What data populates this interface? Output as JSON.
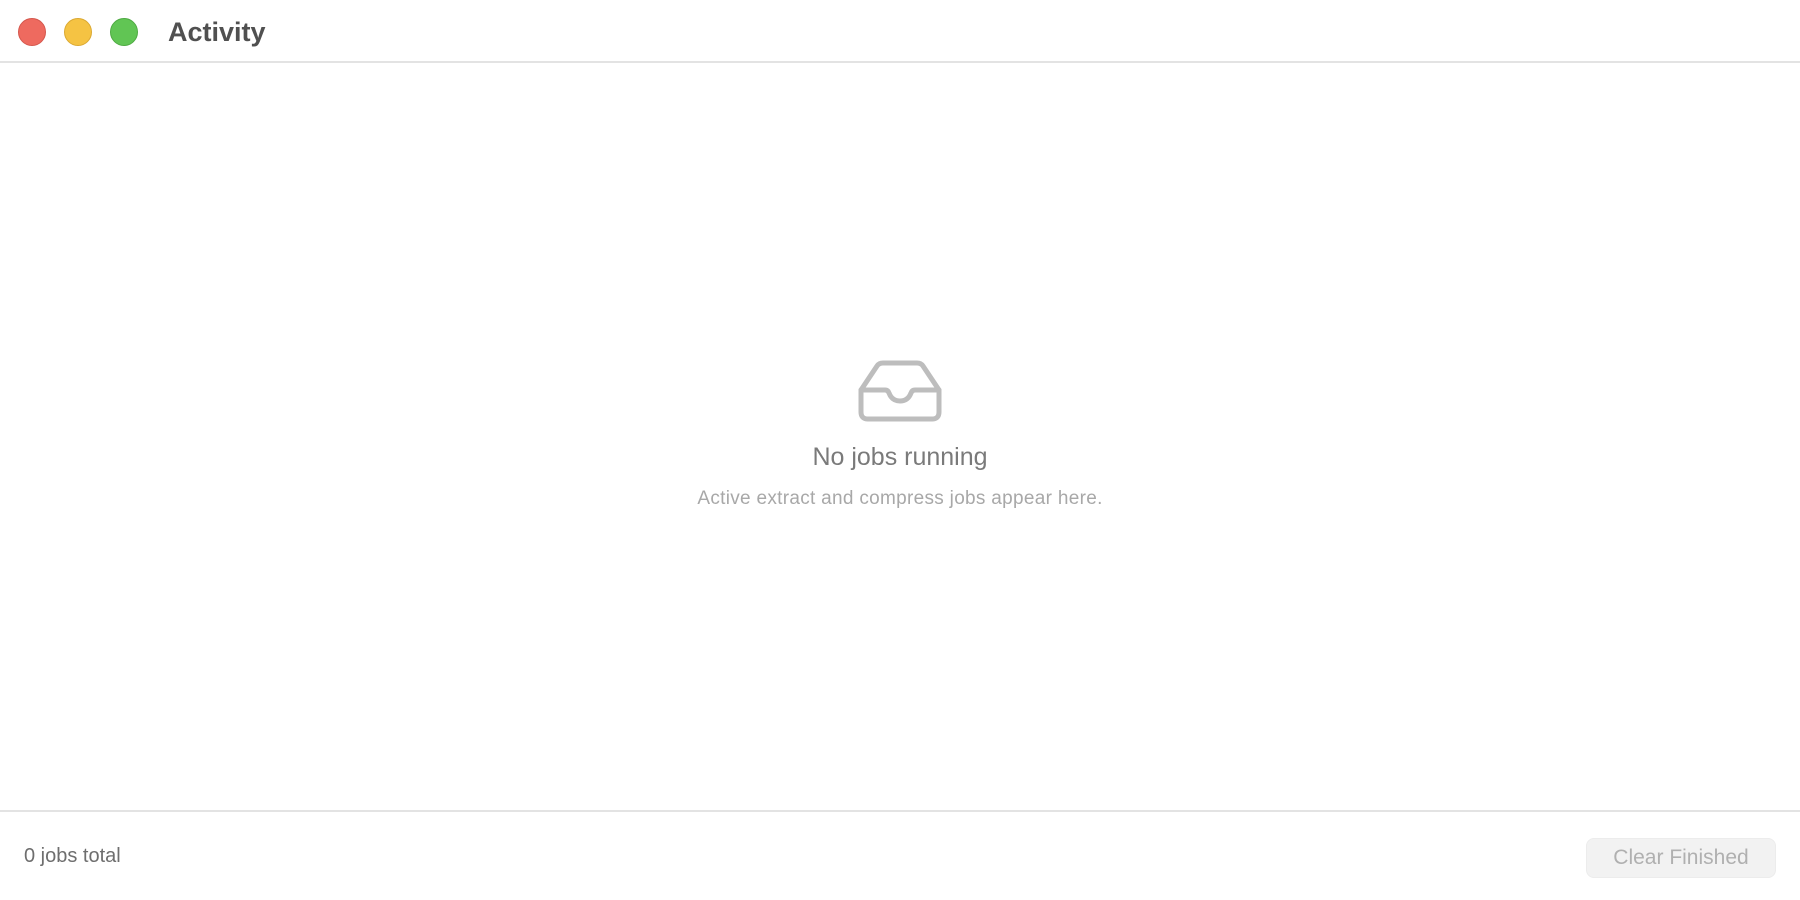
{
  "window": {
    "title": "Activity",
    "controls": {
      "close_color": "#ee6a5f",
      "minimize_color": "#f5c343",
      "zoom_color": "#61c554"
    }
  },
  "empty_state": {
    "icon": "tray-icon",
    "title": "No jobs running",
    "subtitle": "Active extract and compress jobs appear here."
  },
  "footer": {
    "job_count": "0 jobs total",
    "clear_button_label": "Clear Finished",
    "clear_button_disabled": true
  }
}
